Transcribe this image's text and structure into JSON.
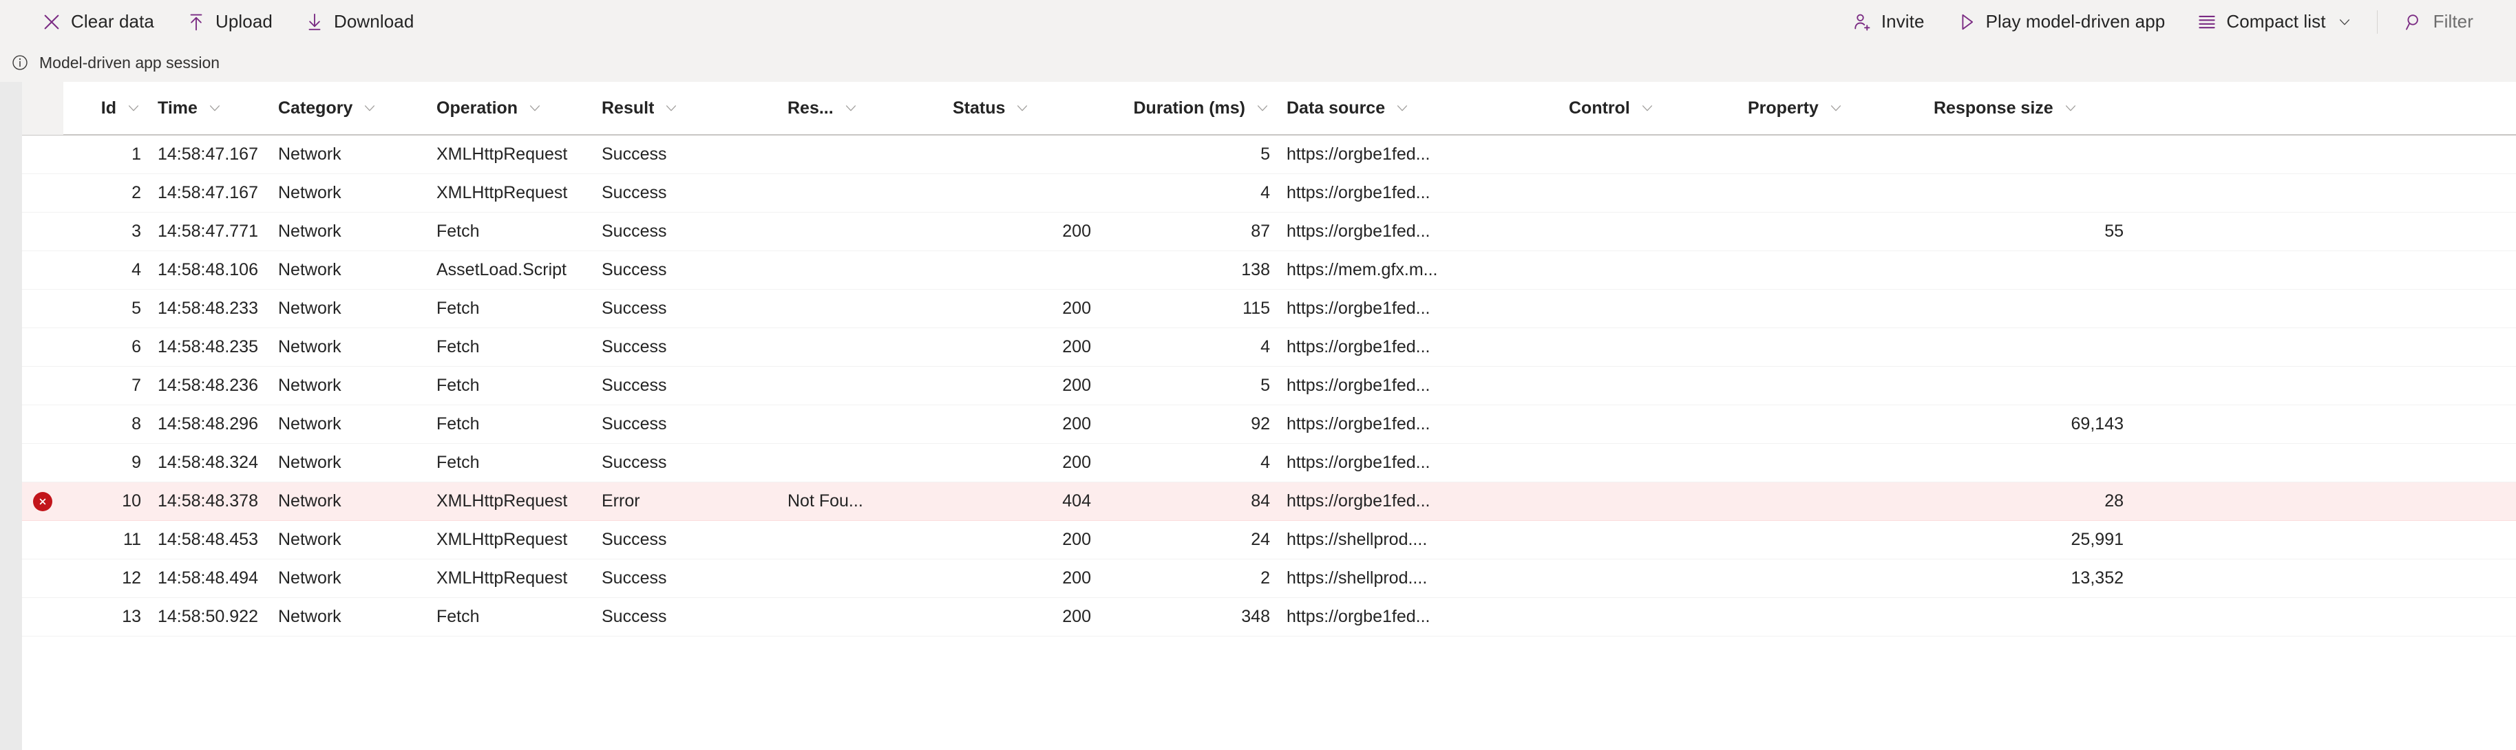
{
  "commandbar": {
    "left_items": [
      {
        "label": "Clear data",
        "icon": "close-x-icon",
        "name": "clear-data-button"
      },
      {
        "label": "Upload",
        "icon": "upload-arrow-icon",
        "name": "upload-button"
      },
      {
        "label": "Download",
        "icon": "download-arrow-icon",
        "name": "download-button"
      }
    ],
    "right_items": [
      {
        "label": "Invite",
        "icon": "person-add-icon",
        "name": "invite-button"
      },
      {
        "label": "Play model-driven app",
        "icon": "play-triangle-icon",
        "name": "play-model-driven-app-button"
      },
      {
        "label": "Compact list",
        "icon": "list-lines-icon",
        "name": "compact-list-button",
        "has_chevron": true
      }
    ],
    "filter": {
      "label": "Filter",
      "icon": "search-magnifier-icon",
      "name": "filter-button"
    },
    "accent_color": "#7a2b83"
  },
  "infobar": {
    "icon": "info-circle-icon",
    "text": "Model-driven app session"
  },
  "grid": {
    "columns": [
      {
        "key": "id",
        "label": "Id",
        "align": "right"
      },
      {
        "key": "time",
        "label": "Time",
        "align": "left"
      },
      {
        "key": "cat",
        "label": "Category",
        "align": "left"
      },
      {
        "key": "op",
        "label": "Operation",
        "align": "left"
      },
      {
        "key": "result",
        "label": "Result",
        "align": "left"
      },
      {
        "key": "resp",
        "label": "Res...",
        "align": "left"
      },
      {
        "key": "status",
        "label": "Status",
        "align": "left"
      },
      {
        "key": "dur",
        "label": "Duration (ms)",
        "align": "right"
      },
      {
        "key": "ds",
        "label": "Data source",
        "align": "left"
      },
      {
        "key": "control",
        "label": "Control",
        "align": "left"
      },
      {
        "key": "prop",
        "label": "Property",
        "align": "left"
      },
      {
        "key": "rsize",
        "label": "Response size",
        "align": "right"
      }
    ],
    "rows": [
      {
        "error": false,
        "id": "1",
        "time": "14:58:47.167",
        "cat": "Network",
        "op": "XMLHttpRequest",
        "result": "Success",
        "resp": "",
        "status": "",
        "dur": "5",
        "ds": "https://orgbe1fed...",
        "control": "",
        "prop": "",
        "rsize": ""
      },
      {
        "error": false,
        "id": "2",
        "time": "14:58:47.167",
        "cat": "Network",
        "op": "XMLHttpRequest",
        "result": "Success",
        "resp": "",
        "status": "",
        "dur": "4",
        "ds": "https://orgbe1fed...",
        "control": "",
        "prop": "",
        "rsize": ""
      },
      {
        "error": false,
        "id": "3",
        "time": "14:58:47.771",
        "cat": "Network",
        "op": "Fetch",
        "result": "Success",
        "resp": "",
        "status": "200",
        "dur": "87",
        "ds": "https://orgbe1fed...",
        "control": "",
        "prop": "",
        "rsize": "55"
      },
      {
        "error": false,
        "id": "4",
        "time": "14:58:48.106",
        "cat": "Network",
        "op": "AssetLoad.Script",
        "result": "Success",
        "resp": "",
        "status": "",
        "dur": "138",
        "ds": "https://mem.gfx.m...",
        "control": "",
        "prop": "",
        "rsize": ""
      },
      {
        "error": false,
        "id": "5",
        "time": "14:58:48.233",
        "cat": "Network",
        "op": "Fetch",
        "result": "Success",
        "resp": "",
        "status": "200",
        "dur": "115",
        "ds": "https://orgbe1fed...",
        "control": "",
        "prop": "",
        "rsize": ""
      },
      {
        "error": false,
        "id": "6",
        "time": "14:58:48.235",
        "cat": "Network",
        "op": "Fetch",
        "result": "Success",
        "resp": "",
        "status": "200",
        "dur": "4",
        "ds": "https://orgbe1fed...",
        "control": "",
        "prop": "",
        "rsize": ""
      },
      {
        "error": false,
        "id": "7",
        "time": "14:58:48.236",
        "cat": "Network",
        "op": "Fetch",
        "result": "Success",
        "resp": "",
        "status": "200",
        "dur": "5",
        "ds": "https://orgbe1fed...",
        "control": "",
        "prop": "",
        "rsize": ""
      },
      {
        "error": false,
        "id": "8",
        "time": "14:58:48.296",
        "cat": "Network",
        "op": "Fetch",
        "result": "Success",
        "resp": "",
        "status": "200",
        "dur": "92",
        "ds": "https://orgbe1fed...",
        "control": "",
        "prop": "",
        "rsize": "69,143"
      },
      {
        "error": false,
        "id": "9",
        "time": "14:58:48.324",
        "cat": "Network",
        "op": "Fetch",
        "result": "Success",
        "resp": "",
        "status": "200",
        "dur": "4",
        "ds": "https://orgbe1fed...",
        "control": "",
        "prop": "",
        "rsize": ""
      },
      {
        "error": true,
        "id": "10",
        "time": "14:58:48.378",
        "cat": "Network",
        "op": "XMLHttpRequest",
        "result": "Error",
        "resp": "Not Fou...",
        "status": "404",
        "dur": "84",
        "ds": "https://orgbe1fed...",
        "control": "",
        "prop": "",
        "rsize": "28"
      },
      {
        "error": false,
        "id": "11",
        "time": "14:58:48.453",
        "cat": "Network",
        "op": "XMLHttpRequest",
        "result": "Success",
        "resp": "",
        "status": "200",
        "dur": "24",
        "ds": "https://shellprod....",
        "control": "",
        "prop": "",
        "rsize": "25,991"
      },
      {
        "error": false,
        "id": "12",
        "time": "14:58:48.494",
        "cat": "Network",
        "op": "XMLHttpRequest",
        "result": "Success",
        "resp": "",
        "status": "200",
        "dur": "2",
        "ds": "https://shellprod....",
        "control": "",
        "prop": "",
        "rsize": "13,352"
      },
      {
        "error": false,
        "id": "13",
        "time": "14:58:50.922",
        "cat": "Network",
        "op": "Fetch",
        "result": "Success",
        "resp": "",
        "status": "200",
        "dur": "348",
        "ds": "https://orgbe1fed...",
        "control": "",
        "prop": "",
        "rsize": ""
      }
    ],
    "error_row_color": "#fdeded",
    "error_icon": "error-circle-x-icon",
    "error_icon_color": "#c2151b"
  }
}
